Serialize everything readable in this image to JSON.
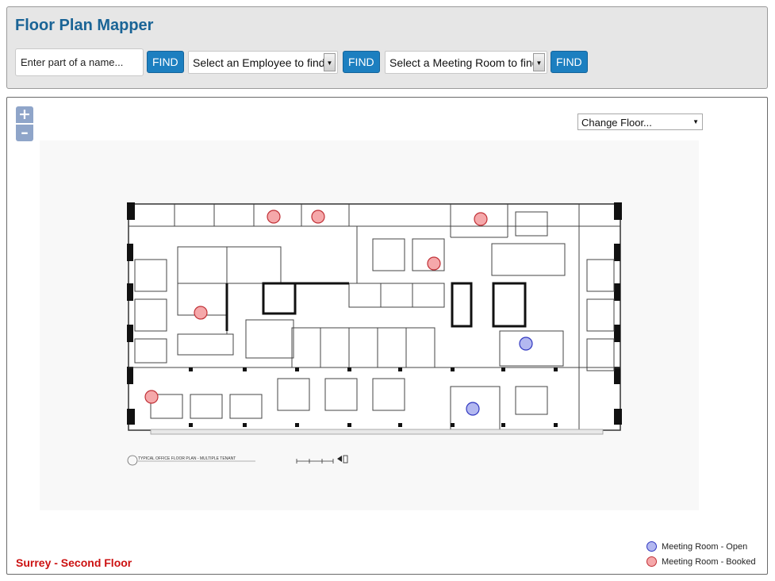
{
  "header": {
    "title": "Floor Plan Mapper",
    "search_placeholder": "Enter part of a name...",
    "find_label": "FIND",
    "employee_select": "Select an Employee to find",
    "room_select": "Select a Meeting Room to find"
  },
  "map": {
    "zoom_in": "+",
    "zoom_out": "–",
    "change_floor": "Change Floor...",
    "plan_caption": "TYPICAL OFFICE FLOOR PLAN - MULTIPLE TENANT",
    "floor_label": "Surrey - Second Floor"
  },
  "legend": {
    "open": "Meeting Room - Open",
    "booked": "Meeting Room - Booked"
  },
  "colors": {
    "title": "#1a6496",
    "button": "#1c7fc0",
    "floor_label": "#cc1111",
    "open_fill": "#b3b8f0",
    "open_stroke": "#3037c0",
    "booked_fill": "#f5a8aa",
    "booked_stroke": "#c03036"
  },
  "markers": [
    {
      "status": "booked"
    },
    {
      "status": "booked"
    },
    {
      "status": "booked"
    },
    {
      "status": "booked"
    },
    {
      "status": "booked"
    },
    {
      "status": "booked"
    },
    {
      "status": "open"
    },
    {
      "status": "open"
    }
  ]
}
